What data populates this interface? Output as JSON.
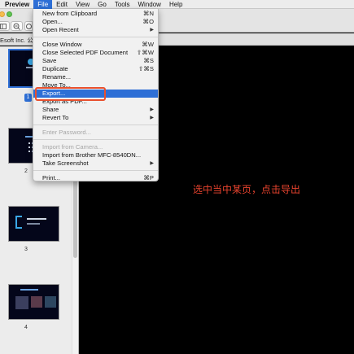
{
  "menubar": {
    "app": "Preview",
    "items": [
      "File",
      "Edit",
      "View",
      "Go",
      "Tools",
      "Window",
      "Help"
    ]
  },
  "toolbar": {
    "zoom_icons": [
      "zoom-out-icon",
      "info-icon"
    ]
  },
  "tab": {
    "title": "Esoft Inc. 公司"
  },
  "sidebar": {
    "pages": [
      {
        "label": "1",
        "selected": true
      },
      {
        "label": "2",
        "selected": false
      },
      {
        "label": "3",
        "selected": false
      },
      {
        "label": "4",
        "selected": false
      }
    ]
  },
  "file_menu": {
    "items": [
      {
        "label": "New from Clipboard",
        "shortcut": "⌘N"
      },
      {
        "label": "Open...",
        "shortcut": "⌘O"
      },
      {
        "label": "Open Recent",
        "submenu": true
      },
      {
        "separator": true
      },
      {
        "label": "Close Window",
        "shortcut": "⌘W"
      },
      {
        "label": "Close Selected PDF Document",
        "shortcut": "⇧⌘W"
      },
      {
        "label": "Save",
        "shortcut": "⌘S"
      },
      {
        "label": "Duplicate",
        "shortcut": "⇧⌘S"
      },
      {
        "label": "Rename..."
      },
      {
        "label": "Move To..."
      },
      {
        "label": "Export...",
        "highlighted": true
      },
      {
        "label": "Export as PDF..."
      },
      {
        "label": "Share",
        "submenu": true
      },
      {
        "label": "Revert To",
        "submenu": true
      },
      {
        "separator": true
      },
      {
        "label": "Enter Password...",
        "disabled": true
      },
      {
        "separator": true
      },
      {
        "label": "Import from Camera...",
        "disabled": true
      },
      {
        "label": "Import from Brother MFC-8540DN..."
      },
      {
        "label": "Take Screenshot",
        "submenu": true
      },
      {
        "separator": true
      },
      {
        "label": "Print...",
        "shortcut": "⌘P"
      }
    ]
  },
  "annotation": {
    "text": "选中当中某页，点击导出",
    "color": "#e8432e"
  },
  "colors": {
    "highlight": "#2e6fd6",
    "callout_box": "#e8502e"
  }
}
